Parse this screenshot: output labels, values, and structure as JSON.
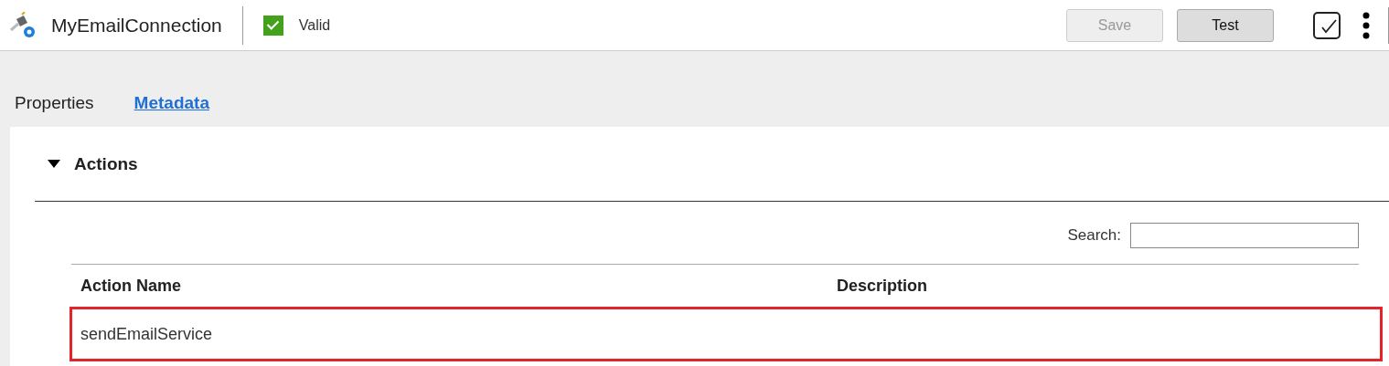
{
  "header": {
    "title": "MyEmailConnection",
    "status": {
      "label": "Valid",
      "checked": true
    },
    "buttons": [
      {
        "label": "Save",
        "disabled": true
      },
      {
        "label": "Test",
        "disabled": false
      }
    ]
  },
  "tabs": [
    {
      "label": "Properties",
      "selected": false
    },
    {
      "label": "Metadata",
      "selected": true
    }
  ],
  "section": {
    "title": "Actions",
    "expanded": true
  },
  "search": {
    "label": "Search:"
  },
  "table": {
    "columns": [
      "Action Name",
      "Description"
    ],
    "rows": [
      {
        "cells": [
          "sendEmailService",
          ""
        ],
        "selected": true
      }
    ]
  }
}
